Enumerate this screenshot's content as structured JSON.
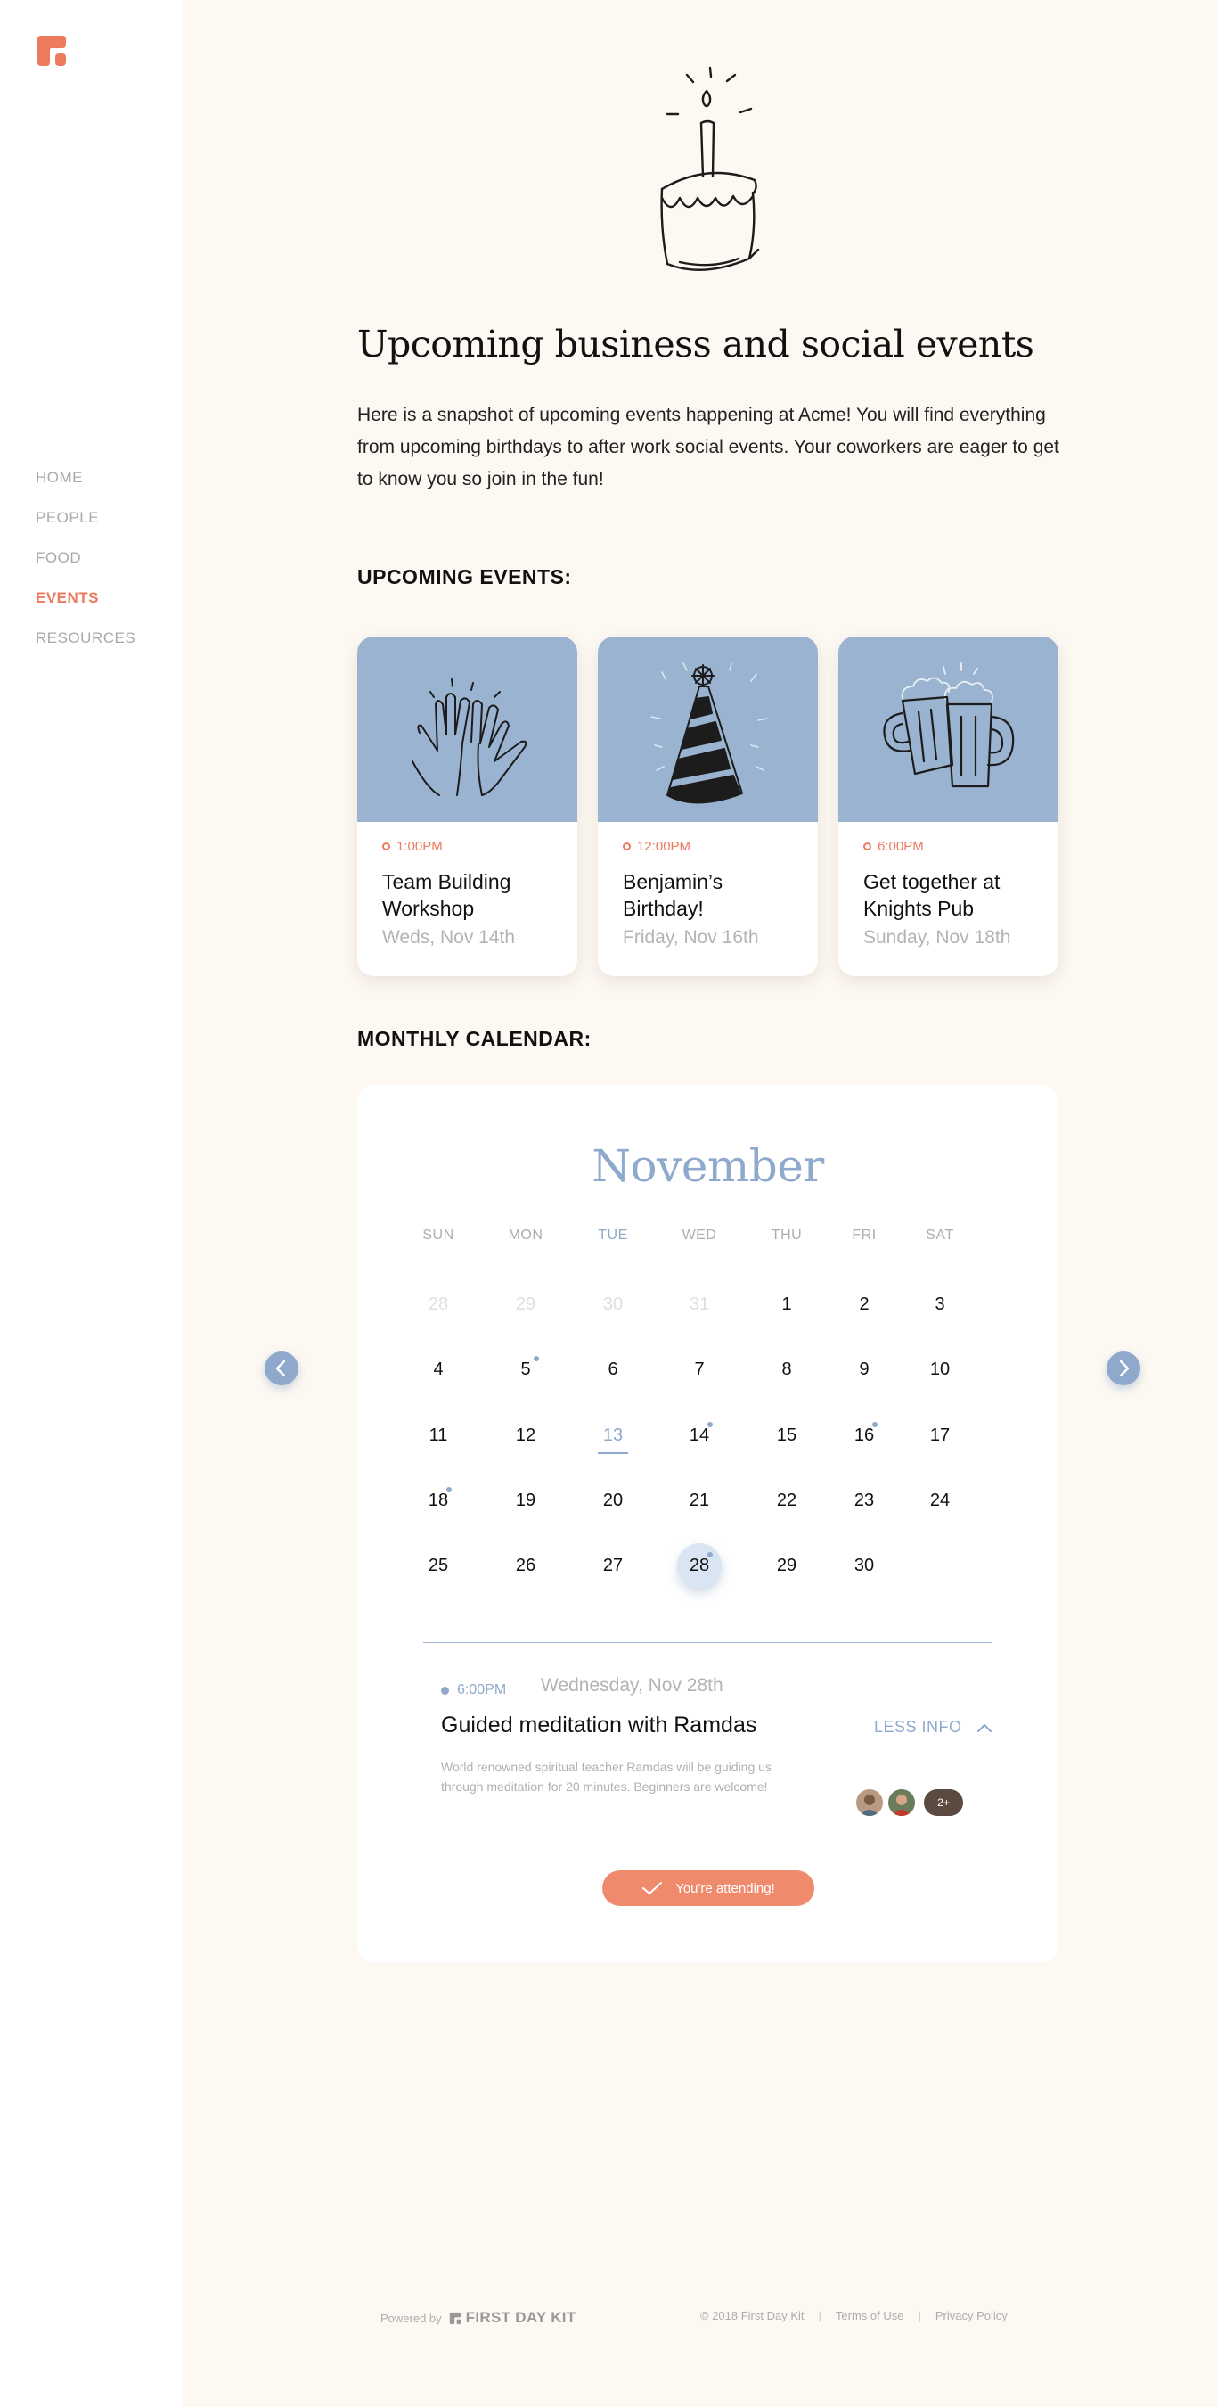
{
  "nav": {
    "items": [
      {
        "label": "HOME",
        "active": false
      },
      {
        "label": "PEOPLE",
        "active": false
      },
      {
        "label": "FOOD",
        "active": false
      },
      {
        "label": "EVENTS",
        "active": true
      },
      {
        "label": "RESOURCES",
        "active": false
      }
    ]
  },
  "page": {
    "title": "Upcoming business and social events",
    "intro": "Here is a snapshot of upcoming events happening at Acme! You will find everything from upcoming birthdays to after work social events. Your coworkers are eager to get to know you so join in the fun!"
  },
  "upcoming": {
    "heading": "UPCOMING EVENTS:",
    "events": [
      {
        "time": "1:00PM",
        "title": "Team Building Workshop",
        "date": "Weds, Nov 14th",
        "icon": "high-five-hands-icon"
      },
      {
        "time": "12:00PM",
        "title": "Benjamin’s Birthday!",
        "date": "Friday, Nov 16th",
        "icon": "party-hat-icon"
      },
      {
        "time": "6:00PM",
        "title": "Get together at Knights Pub",
        "date": "Sunday, Nov 18th",
        "icon": "beer-mugs-icon"
      }
    ]
  },
  "calendar": {
    "heading": "MONTHLY CALENDAR:",
    "month": "November",
    "weekdays": [
      "SUN",
      "MON",
      "TUE",
      "WED",
      "THU",
      "FRI",
      "SAT"
    ],
    "today_weekday_index": 2,
    "weeks": [
      [
        {
          "d": "28",
          "muted": true
        },
        {
          "d": "29",
          "muted": true
        },
        {
          "d": "30",
          "muted": true
        },
        {
          "d": "31",
          "muted": true
        },
        {
          "d": "1"
        },
        {
          "d": "2"
        },
        {
          "d": "3"
        }
      ],
      [
        {
          "d": "4"
        },
        {
          "d": "5",
          "event": true
        },
        {
          "d": "6"
        },
        {
          "d": "7"
        },
        {
          "d": "8"
        },
        {
          "d": "9"
        },
        {
          "d": "10"
        }
      ],
      [
        {
          "d": "11"
        },
        {
          "d": "12"
        },
        {
          "d": "13",
          "today": true
        },
        {
          "d": "14",
          "event": true
        },
        {
          "d": "15"
        },
        {
          "d": "16",
          "event": true
        },
        {
          "d": "17"
        }
      ],
      [
        {
          "d": "18",
          "event": true
        },
        {
          "d": "19"
        },
        {
          "d": "20"
        },
        {
          "d": "21"
        },
        {
          "d": "22"
        },
        {
          "d": "23"
        },
        {
          "d": "24"
        }
      ],
      [
        {
          "d": "25"
        },
        {
          "d": "26"
        },
        {
          "d": "27"
        },
        {
          "d": "28",
          "selected": true,
          "event": true
        },
        {
          "d": "29"
        },
        {
          "d": "30"
        }
      ]
    ],
    "selected_event": {
      "time": "6:00PM",
      "date": "Wednesday, Nov 28th",
      "title": "Guided meditation with Ramdas",
      "toggle_label": "LESS INFO",
      "description": "World renowned spiritual teacher Ramdas will be guiding us through meditation for 20 minutes. Beginners are welcome!",
      "more_attendees": "2+",
      "attend_label": "You're attending!"
    }
  },
  "footer": {
    "powered_by": "Powered by",
    "brand": "FIRST DAY KIT",
    "copyright": "© 2018 First Day Kit",
    "terms": "Terms of Use",
    "privacy": "Privacy Policy",
    "separator": "|"
  },
  "colors": {
    "accent": "#ee7a5e",
    "calendar_blue": "#8ea9cc",
    "card_art_blue": "#9ab3d0",
    "background": "#fdf8f2"
  }
}
